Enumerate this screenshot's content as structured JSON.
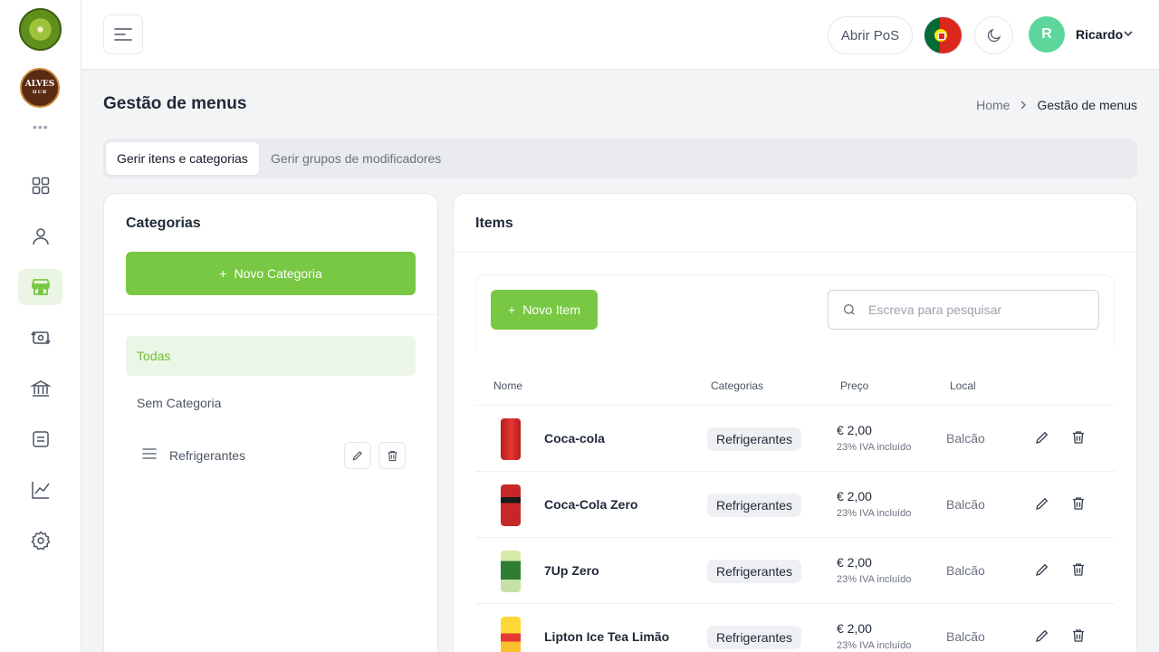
{
  "sidebar": {
    "logo_kiwi": "kiwi-logo",
    "logo_alves_text": "ALVES",
    "logo_alves_sub": "HUB",
    "more": "•••",
    "items": [
      {
        "name": "dashboard-icon"
      },
      {
        "name": "user-icon"
      },
      {
        "name": "store-icon",
        "active": true
      },
      {
        "name": "transfer-icon"
      },
      {
        "name": "bank-icon"
      },
      {
        "name": "document-icon"
      },
      {
        "name": "chart-line-icon"
      },
      {
        "name": "settings-icon"
      }
    ]
  },
  "header": {
    "pos_button": "Abrir PoS",
    "language_flag": "Portugal",
    "avatar_initial": "R",
    "user_name": "Ricardo"
  },
  "page": {
    "title": "Gestão de menus",
    "breadcrumb": {
      "home": "Home",
      "current": "Gestão de menus"
    }
  },
  "tabs": {
    "active": "Gerir itens e categorias",
    "inactive": "Gerir grupos de modificadores"
  },
  "categories": {
    "title": "Categorias",
    "new_button": "Novo Categoria",
    "all": "Todas",
    "none": "Sem Categoria",
    "list": [
      {
        "label": "Refrigerantes"
      }
    ]
  },
  "items": {
    "title": "Items",
    "new_button": "Novo Item",
    "search_placeholder": "Escreva para pesquisar",
    "columns": {
      "name": "Nome",
      "categories": "Categorias",
      "price": "Preço",
      "local": "Local"
    },
    "rows": [
      {
        "name": "Coca-cola",
        "category": "Refrigerantes",
        "price": "€ 2,00",
        "tax": "23% IVA incluído",
        "local": "Balcão"
      },
      {
        "name": "Coca-Cola Zero",
        "category": "Refrigerantes",
        "price": "€ 2,00",
        "tax": "23% IVA incluído",
        "local": "Balcão"
      },
      {
        "name": "7Up Zero",
        "category": "Refrigerantes",
        "price": "€ 2,00",
        "tax": "23% IVA incluído",
        "local": "Balcão"
      },
      {
        "name": "Lipton Ice Tea Limão",
        "category": "Refrigerantes",
        "price": "€ 2,00",
        "tax": "23% IVA incluído",
        "local": "Balcão"
      }
    ]
  },
  "colors": {
    "accent_green": "#78c843",
    "accent_green_light": "#ecf6e6",
    "avatar_green": "#5cd69a"
  }
}
